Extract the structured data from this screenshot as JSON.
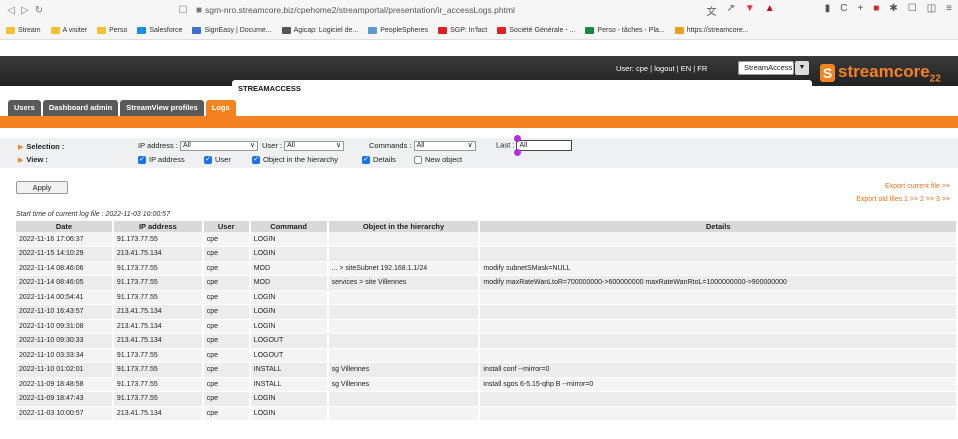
{
  "browser": {
    "url": "sgm-nro.streamcore.biz/cpehome2/streamportal/presentation/ir_accessLogs.phtml",
    "bookmarks": [
      "Stream",
      "A visiter",
      "Perso",
      "Salesforce",
      "SignEasy | Docume...",
      "Agicap: Logiciel de...",
      "PeopleSpheres",
      "SGP: In'fact",
      "Société Générale - ...",
      "Perso - tâches - Pla...",
      "https://streamcore..."
    ]
  },
  "header": {
    "app_title": "STREAMACCESS",
    "user_info": "User: cpe | logout | EN | FR",
    "product_select": "StreamAccess",
    "logo_text": "streamcore",
    "logo_sub": "22"
  },
  "tabs": [
    {
      "label": "Users"
    },
    {
      "label": "Dashboard admin"
    },
    {
      "label": "StreamView profiles"
    },
    {
      "label": "Logs"
    }
  ],
  "selection": {
    "selection_label": "Selection :",
    "view_label": "View :",
    "ip_label": "IP address :",
    "ip_value": "All",
    "user_label": "User :",
    "user_value": "All",
    "commands_label": "Commands :",
    "commands_value": "All",
    "last_label": "Last :",
    "last_value": "All",
    "view_options": [
      "IP address",
      "User",
      "Object in the hierarchy",
      "Details",
      "New object"
    ]
  },
  "actions": {
    "apply": "Apply",
    "export_current": "Export current file >>",
    "export_old": "Export old files 1 >> 2 >> 3 >>"
  },
  "start_time": "Start time of current log file : 2022-11-03 10:00:57",
  "table": {
    "headers": [
      "Date",
      "IP address",
      "User",
      "Command",
      "Object in the hierarchy",
      "Details"
    ],
    "rows": [
      [
        "2022-11-16 17:06:37",
        "91.173.77.55",
        "cpe",
        "LOGIN",
        "",
        ""
      ],
      [
        "2022-11-15 14:10:29",
        "213.41.75.134",
        "cpe",
        "LOGIN",
        "",
        ""
      ],
      [
        "2022-11-14 08:46:06",
        "91.173.77.55",
        "cpe",
        "MOD",
        "... > siteSubnet 192.168.1.1/24",
        "modify subnetSMask=NULL"
      ],
      [
        "2022-11-14 08:46:05",
        "91.173.77.55",
        "cpe",
        "MOD",
        "services > site Villennes",
        "modify maxRateWanLtoR=700000000->600000000 maxRateWanRtoL=1000000000->900000000"
      ],
      [
        "2022-11-14 00:54:41",
        "91.173.77.55",
        "cpe",
        "LOGIN",
        "",
        ""
      ],
      [
        "2022-11-10 16:43:57",
        "213.41.75.134",
        "cpe",
        "LOGIN",
        "",
        ""
      ],
      [
        "2022-11-10 09:31:08",
        "213.41.75.134",
        "cpe",
        "LOGIN",
        "",
        ""
      ],
      [
        "2022-11-10 09:30:33",
        "213.41.75.134",
        "cpe",
        "LOGOUT",
        "",
        ""
      ],
      [
        "2022-11-10 03:33:34",
        "91.173.77.55",
        "cpe",
        "LOGOUT",
        "",
        ""
      ],
      [
        "2022-11-10 01:02:01",
        "91.173.77.55",
        "cpe",
        "INSTALL",
        "sg Villennes",
        "install conf --mirror=0"
      ],
      [
        "2022-11-09 18:48:58",
        "91.173.77.55",
        "cpe",
        "INSTALL",
        "sg Villennes",
        "install sgos 6-5.15-qhp B --mirror=0"
      ],
      [
        "2022-11-09 18:47:43",
        "91.173.77.55",
        "cpe",
        "LOGIN",
        "",
        ""
      ],
      [
        "2022-11-03 10:00:57",
        "213.41.75.134",
        "cpe",
        "LOGIN",
        "",
        ""
      ]
    ]
  }
}
